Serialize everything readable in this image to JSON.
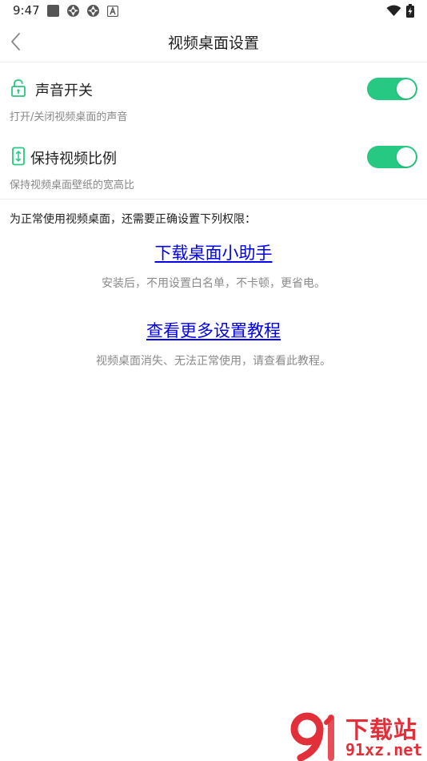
{
  "status_bar": {
    "time": "9:47"
  },
  "header": {
    "title": "视频桌面设置"
  },
  "settings": [
    {
      "label": "声音开关",
      "description": "打开/关闭视频桌面的声音",
      "enabled": true,
      "icon": "unlock-icon"
    },
    {
      "label": "保持视频比例",
      "description": "保持视频桌面壁纸的宽高比",
      "enabled": true,
      "icon": "phone-ratio-icon"
    }
  ],
  "permissions": {
    "intro": "为正常使用视频桌面，还需要正确设置下列权限：",
    "links": [
      {
        "label": "下载桌面小助手",
        "description": "安装后，不用设置白名单，不卡顿，更省电。"
      },
      {
        "label": "查看更多设置教程",
        "description": "视频桌面消失、无法正常使用，请查看此教程。"
      }
    ]
  },
  "watermark": {
    "top": "下载站",
    "bottom": "91xz.net"
  },
  "colors": {
    "accent": "#27c881",
    "link": "#0000ee",
    "watermark": "#e2303a"
  }
}
